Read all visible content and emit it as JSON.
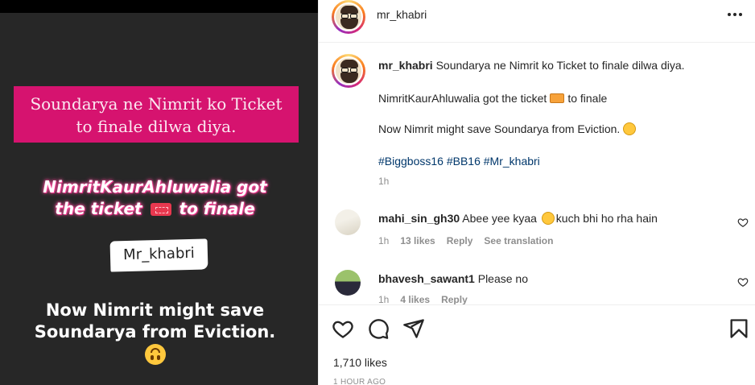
{
  "media": {
    "pink_box_lines": [
      "Soundarya ne Nimrit ko Ticket",
      "to finale dilwa diya."
    ],
    "neon_lines": [
      "NimritKaurAhluwalia got",
      "the ticket",
      "to finale"
    ],
    "brush_label": "Mr_khabri",
    "white_lines": [
      "Now Nimrit might save",
      "Soundarya from Eviction."
    ]
  },
  "header": {
    "username": "mr_khabri"
  },
  "caption": {
    "username": "mr_khabri",
    "line1": "Soundarya ne Nimrit ko Ticket to finale dilwa diya.",
    "line2_a": "NimritKaurAhluwalia got the ticket",
    "line2_b": "to finale",
    "line3": "Now Nimrit might save Soundarya from Eviction.",
    "hashtags": "#Biggboss16 #BB16 #Mr_khabri",
    "time": "1h"
  },
  "comments": [
    {
      "username": "mahi_sin_gh30",
      "text_a": "Abee yee kyaa",
      "text_b": "kuch bhi ho rha hain",
      "time": "1h",
      "likes": "13 likes",
      "reply": "Reply",
      "translate": "See translation"
    },
    {
      "username": "bhavesh_sawant1",
      "text": "Please no",
      "time": "1h",
      "likes": "4 likes",
      "reply": "Reply"
    }
  ],
  "footer": {
    "likes": "1,710 likes",
    "time_ago": "1 HOUR AGO"
  },
  "icons": {
    "like": "heart-icon",
    "comment": "comment-icon",
    "share": "share-icon",
    "save": "bookmark-icon",
    "more": "more-options-icon"
  }
}
